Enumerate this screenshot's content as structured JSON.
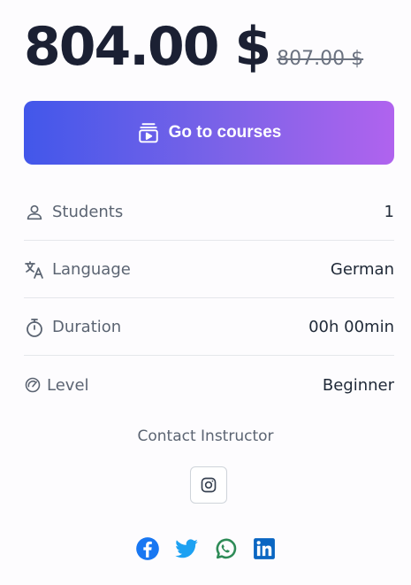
{
  "price": {
    "current": "804.00 $",
    "original": "807.00 $"
  },
  "cta": {
    "label": "Go to courses",
    "icon": "video-library-icon"
  },
  "details": [
    {
      "label": "Students",
      "value": "1",
      "icon": "user-icon"
    },
    {
      "label": "Language",
      "value": "German",
      "icon": "translate-icon"
    },
    {
      "label": "Duration",
      "value": "00h 00min",
      "icon": "stopwatch-icon"
    },
    {
      "label": "Level",
      "value": "Beginner",
      "icon": "gauge-icon"
    }
  ],
  "contact": {
    "label": "Contact Instructor",
    "icon": "instagram-icon"
  },
  "share": [
    {
      "name": "facebook",
      "color": "#1877f2"
    },
    {
      "name": "twitter",
      "color": "#1da1f2"
    },
    {
      "name": "whatsapp",
      "color": "#2e8b57"
    },
    {
      "name": "linkedin",
      "color": "#0a66c2"
    }
  ],
  "colors": {
    "accent_start": "#4257ea",
    "accent_end": "#b063ee"
  }
}
